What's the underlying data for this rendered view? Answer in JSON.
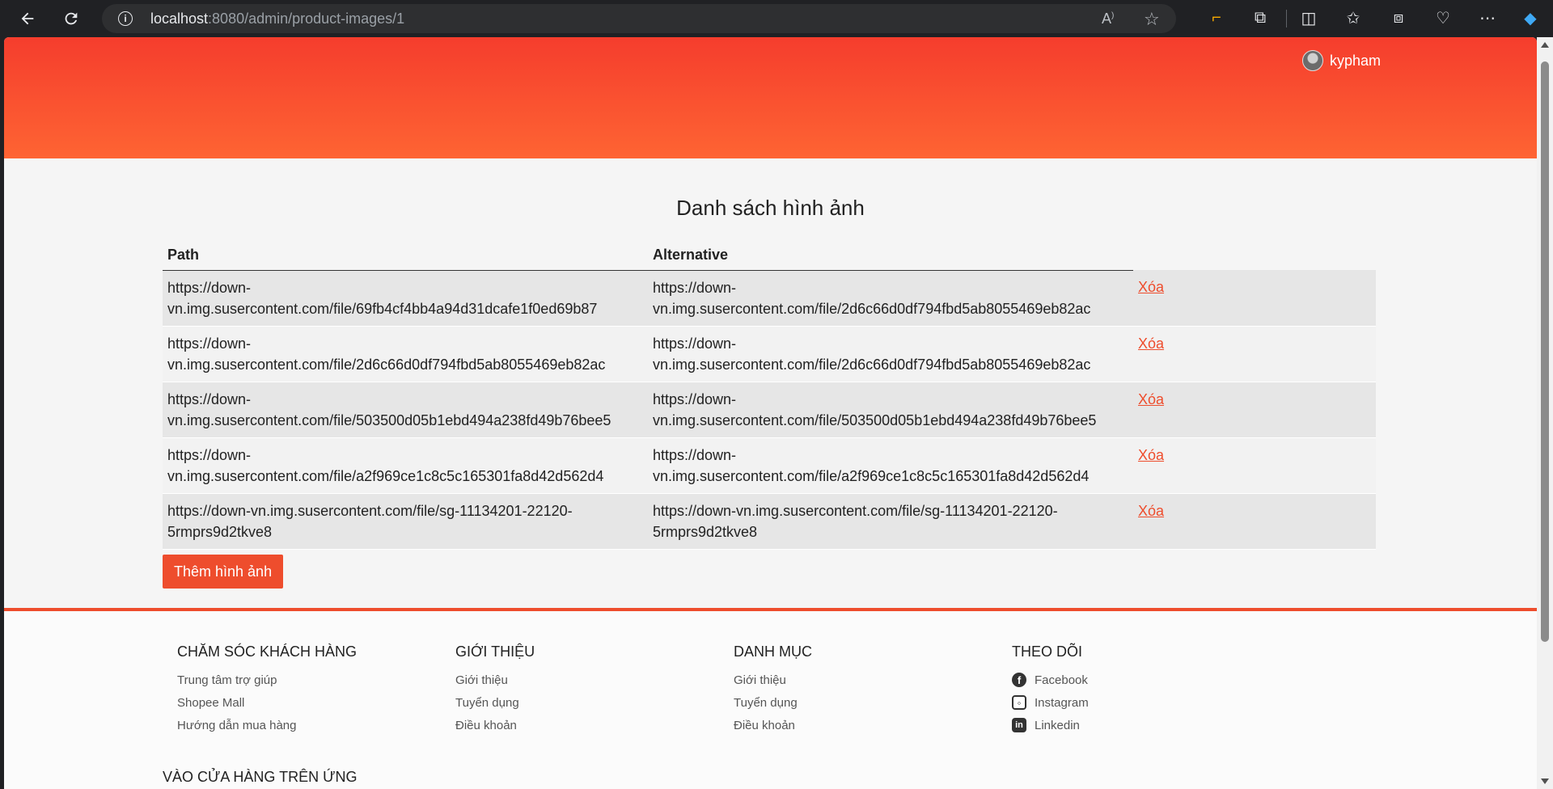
{
  "browser": {
    "url_host": "localhost",
    "url_path": ":8080/admin/product-images/1",
    "info_icon": "info-icon",
    "reader_icon": "read-aloud-icon",
    "favorite_icon": "star-icon"
  },
  "header": {
    "username": "kypham"
  },
  "main": {
    "title": "Danh sách hình ảnh",
    "columns": [
      "Path",
      "Alternative"
    ],
    "rows": [
      {
        "path": "https://down-vn.img.susercontent.com/file/69fb4cf4bb4a94d31dcafe1f0ed69b87",
        "alt": "https://down-vn.img.susercontent.com/file/2d6c66d0df794fbd5ab8055469eb82ac",
        "action": "Xóa"
      },
      {
        "path": "https://down-vn.img.susercontent.com/file/2d6c66d0df794fbd5ab8055469eb82ac",
        "alt": "https://down-vn.img.susercontent.com/file/2d6c66d0df794fbd5ab8055469eb82ac",
        "action": "Xóa"
      },
      {
        "path": "https://down-vn.img.susercontent.com/file/503500d05b1ebd494a238fd49b76bee5",
        "alt": "https://down-vn.img.susercontent.com/file/503500d05b1ebd494a238fd49b76bee5",
        "action": "Xóa"
      },
      {
        "path": "https://down-vn.img.susercontent.com/file/a2f969ce1c8c5c165301fa8d42d562d4",
        "alt": "https://down-vn.img.susercontent.com/file/a2f969ce1c8c5c165301fa8d42d562d4",
        "action": "Xóa"
      },
      {
        "path": "https://down-vn.img.susercontent.com/file/sg-11134201-22120-5rmprs9d2tkve8",
        "alt": "https://down-vn.img.susercontent.com/file/sg-11134201-22120-5rmprs9d2tkve8",
        "action": "Xóa"
      }
    ],
    "add_button": "Thêm hình ảnh"
  },
  "footer": {
    "columns": [
      {
        "title": "CHĂM SÓC KHÁCH HÀNG",
        "links": [
          "Trung tâm trợ giúp",
          "Shopee Mall",
          "Hướng dẫn mua hàng"
        ]
      },
      {
        "title": "GIỚI THIỆU",
        "links": [
          "Giới thiệu",
          "Tuyển dụng",
          "Điều khoản"
        ]
      },
      {
        "title": "DANH MỤC",
        "links": [
          "Giới thiệu",
          "Tuyển dụng",
          "Điều khoản"
        ]
      },
      {
        "title": "THEO DÕI",
        "links": [
          "Facebook",
          "Instagram",
          "Linkedin"
        ]
      }
    ],
    "app_title": "VÀO CỬA HÀNG TRÊN ỨNG DỤNG"
  },
  "colors": {
    "brand": "#ee4d2d",
    "header_top": "#f53d2d",
    "header_bottom": "#fe6433"
  }
}
